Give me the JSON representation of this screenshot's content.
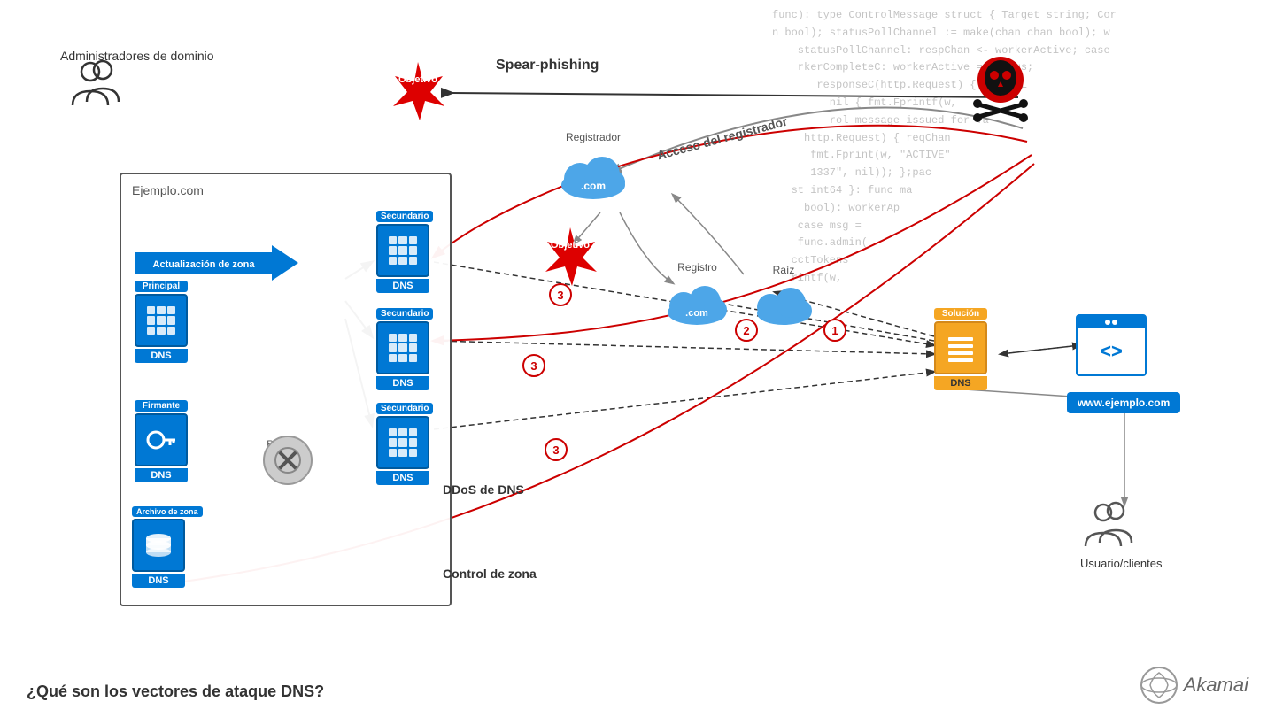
{
  "diagram": {
    "title": "¿Qué son los vectores de ataque DNS?",
    "code_lines": [
      "func): type ControlMessage struct { Target string; Cor",
      "n bool); statusPollChannel := make(chan chan bool); w",
      "statusPollChannel: respChan <- workerActive; case",
      "rkerCompleteC: workerActive = status;",
      "responseC(http.Request) { hostToL",
      "nil { fmt.Fprintf(w,",
      "rol message issued for Ta",
      "http.Request) { reqChan",
      "fmt.Fprint(w, \"ACTIVE\"",
      "1337\", nil)); };pac",
      "st int64 }: func ma",
      "bool): workerAp",
      "case msg =",
      "func.admin(",
      "cctTokens",
      "rintf(w,"
    ],
    "labels": {
      "admin_title": "Administradores de dominio",
      "spear_phishing": "Spear-phishing",
      "registrador": "Registrador",
      "registro": "Registro",
      "raiz": "Raíz",
      "objetivo1": "Objetivo",
      "objetivo2": "Objetivo",
      "acceso_registrador": "Acceso del registrador",
      "ejemplo_com": "Ejemplo.com",
      "zona_update": "Actualización de zona",
      "principal": "Principal",
      "firmante": "Firmante",
      "archivo_zona": "Archivo de zona",
      "secundario": "Secundario",
      "router_label": "Router\ncon ACL",
      "solucion": "Solución",
      "ddos_dns": "DDoS de DNS",
      "control_zona": "Control de zona",
      "dns_label": "DNS",
      "www_label": "www.ejemplo.com",
      "usuario_clientes": "Usuario/clientes",
      "bottom_question": "¿Qué son los vectores de ataque DNS?",
      "akamai": "Akamai"
    }
  }
}
